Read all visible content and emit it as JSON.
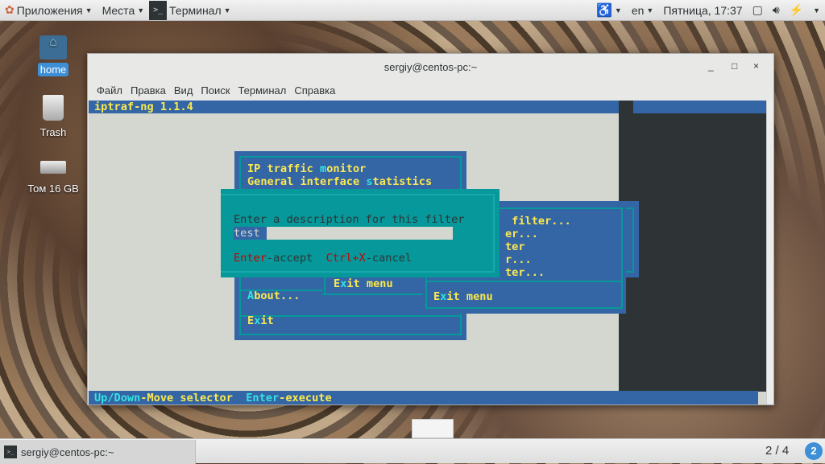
{
  "topbar": {
    "apps": "Приложения",
    "places": "Места",
    "terminal": "Терминал",
    "lang": "en",
    "clock": "Пятница, 17:37"
  },
  "desktop": {
    "home": "home",
    "trash": "Trash",
    "volume": "Том 16 GB"
  },
  "window": {
    "title": "sergiy@centos-pc:~",
    "menu": [
      "Файл",
      "Правка",
      "Вид",
      "Поиск",
      "Терминал",
      "Справка"
    ]
  },
  "terminal": {
    "header": "iptraf-ng 1.1.4",
    "main_menu": [
      {
        "pre": "IP traffic ",
        "hot": "m",
        "post": "onitor"
      },
      {
        "pre": "General interface ",
        "hot": "s",
        "post": "tatistics"
      },
      {
        "pre": "",
        "hot": "A",
        "post": "bout..."
      },
      {
        "pre": "E",
        "hot": "x",
        "post": "it"
      }
    ],
    "sub_menu_items": [
      " filter...",
      "er...",
      "ter",
      "r...",
      "ter..."
    ],
    "exit_menu_mid": {
      "pre": "E",
      "hot": "x",
      "post": "it menu"
    },
    "exit_menu_right": {
      "pre": "E",
      "hot": "x",
      "post": "it menu"
    },
    "dialog": {
      "prompt": "Enter a description for this filter",
      "value": "test",
      "accept_key": "Enter",
      "accept_label": "-accept",
      "cancel_key": "Ctrl+X",
      "cancel_label": "-cancel"
    },
    "status": {
      "k1": "Up/Down",
      "l1": "-Move selector",
      "k2": "Enter",
      "l2": "-execute"
    }
  },
  "taskbar": {
    "task": "sergiy@centos-pc:~",
    "workspace": "2 / 4",
    "notif": "2"
  }
}
